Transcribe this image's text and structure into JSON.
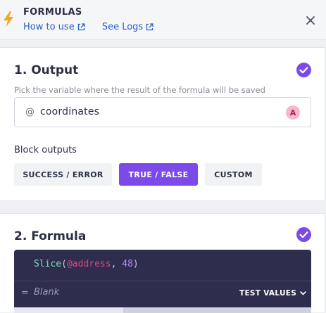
{
  "header": {
    "title": "FORMULAS",
    "how_to_use": "How to use",
    "see_logs": "See Logs",
    "icon": "lightning-bolt-icon",
    "accent_color": "#f5a623"
  },
  "output": {
    "heading": "1. Output",
    "hint": "Pick the variable where the result of the formula will be saved",
    "var_prefix": "@",
    "var_value": "coordinates",
    "avatar_letter": "A",
    "block_outputs_label": "Block outputs",
    "buttons": [
      "SUCCESS / ERROR",
      "TRUE / FALSE",
      "CUSTOM"
    ],
    "selected_button": "TRUE / FALSE",
    "accent_color": "#7b4ae8"
  },
  "formula": {
    "heading": "2. Formula",
    "code": {
      "fn": "Slice",
      "open": "(",
      "var": "@address",
      "sep": ", ",
      "num": "48",
      "close": ")"
    },
    "result_prefix": "=",
    "result_value": "Blank",
    "test_values_label": "TEST VALUES"
  }
}
